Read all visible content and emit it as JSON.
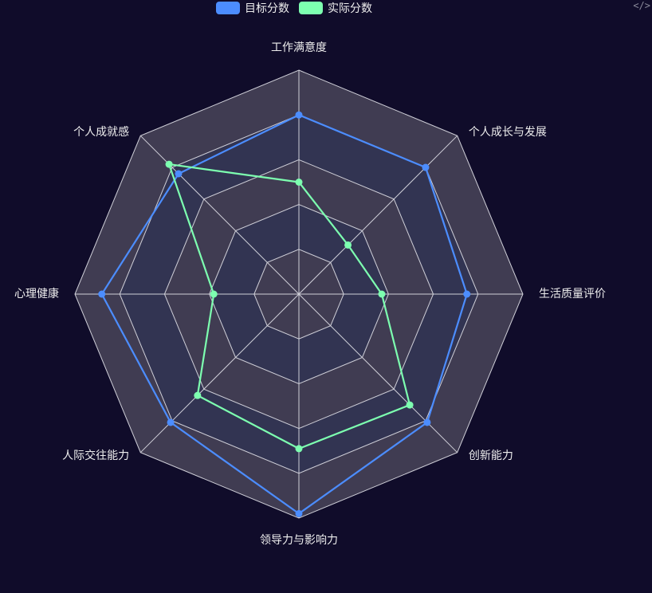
{
  "legend": {
    "target_label": "目标分数",
    "actual_label": "实际分数"
  },
  "corner_icon_text": "</>",
  "colors": {
    "background": "#100c2a",
    "target": "#4c8dff",
    "actual": "#7dffb0",
    "split_area_dark": "#323452",
    "split_area_light": "#403c52",
    "split_line": "#cfcfd8",
    "label": "#eeeeee"
  },
  "chart_data": {
    "type": "radar",
    "max": 100,
    "split_count": 5,
    "indicators": [
      "工作满意度",
      "个人成长与发展",
      "生活质量评价",
      "创新能力",
      "领导力与影响力",
      "人际交往能力",
      "心理健康",
      "个人成就感"
    ],
    "series": [
      {
        "name": "目标分数",
        "values": [
          80,
          80,
          75,
          81,
          98,
          81,
          88,
          76
        ]
      },
      {
        "name": "实际分数",
        "values": [
          50,
          31,
          37,
          70,
          69,
          64,
          38,
          82
        ]
      }
    ]
  }
}
